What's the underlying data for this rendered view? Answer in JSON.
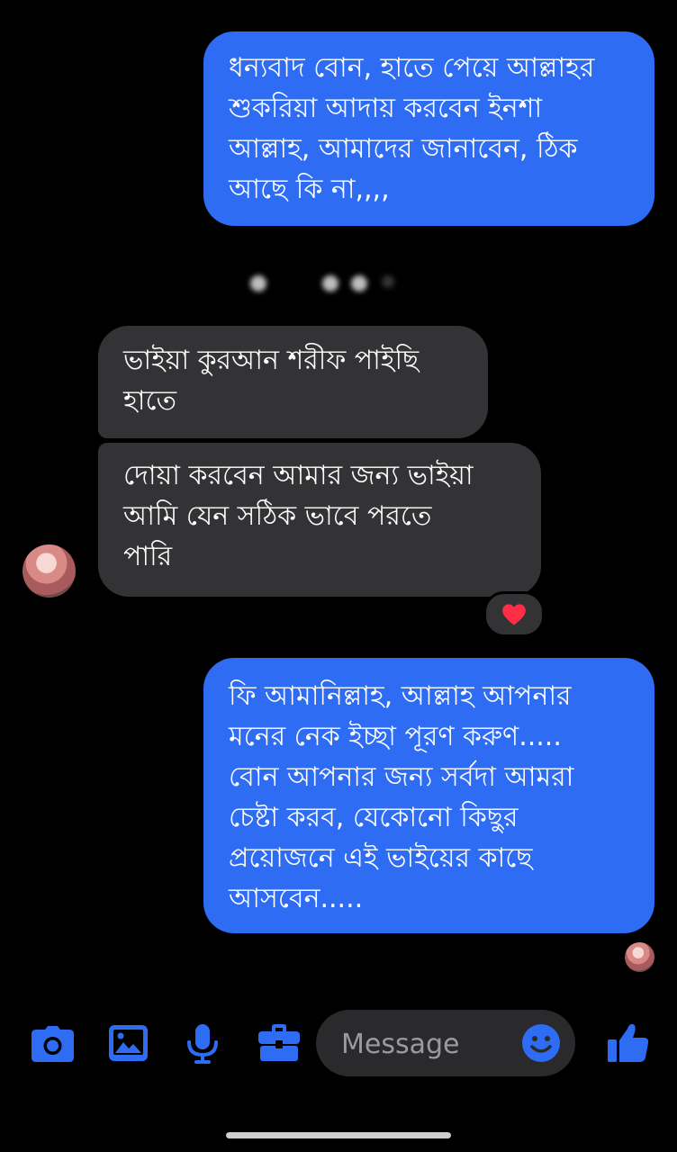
{
  "accent_color": "#2f6cf4",
  "messages": [
    {
      "direction": "outgoing",
      "text": "ধন্যবাদ বোন, হাতে পেয়ে আল্লাহর\nশুকরিয়া আদায় করবেন ইনশা\nআল্লাহ, আমাদের জানাবেন, ঠিক\nআছে কি না,,,,"
    },
    {
      "direction": "incoming",
      "text": "ভাইয়া কুরআন শরীফ  পাইছি\nহাতে"
    },
    {
      "direction": "incoming",
      "text": "দোয়া করবেন আমার জন্য ভাইয়া\nআমি যেন সঠিক ভাবে পরতে\nপারি",
      "reaction": "heart"
    },
    {
      "direction": "outgoing",
      "text": "ফি আমানিল্লাহ, আল্লাহ আপনার\nমনের নেক ইচ্ছা পূরণ করুণ.....\nবোন আপনার জন্য সর্বদা আমরা\nচেষ্টা করব, যেকোনো কিছুর\nপ্রয়োজনে এই ভাইয়ের কাছে\nআসবেন....."
    }
  ],
  "composer": {
    "placeholder": "Message",
    "icons": [
      "camera-icon",
      "image-icon",
      "microphone-icon",
      "briefcase-icon",
      "emoji-icon",
      "thumbs-up-icon"
    ]
  }
}
